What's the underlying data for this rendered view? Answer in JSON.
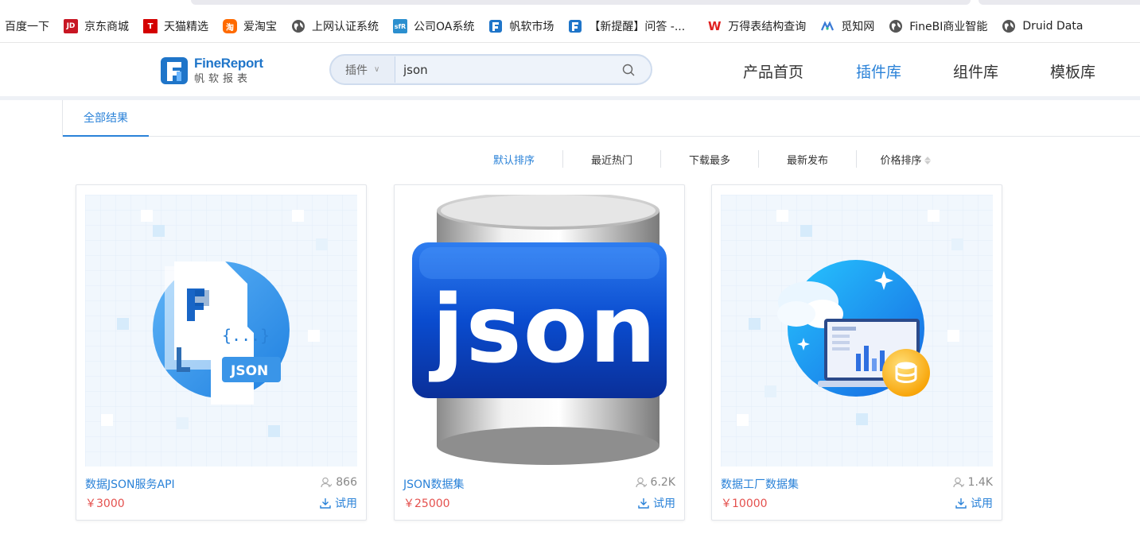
{
  "bookmarks": [
    {
      "label": "百度一下",
      "icon": "none"
    },
    {
      "label": "京东商城",
      "icon": "jd-icon",
      "mark": "JD",
      "color": "#c81623"
    },
    {
      "label": "天猫精选",
      "icon": "tmall-icon",
      "mark": "T",
      "color": "#d40000"
    },
    {
      "label": "爱淘宝",
      "icon": "taobao-icon",
      "mark": "淘",
      "color": "#ff6a00"
    },
    {
      "label": "上网认证系统",
      "icon": "globe-icon",
      "mark": "",
      "color": "#555555"
    },
    {
      "label": "公司OA系统",
      "icon": "oa-icon",
      "mark": "sfR",
      "color": "#2b8fcf"
    },
    {
      "label": "帆软市场",
      "icon": "fanruan-icon",
      "mark": "",
      "color": "#1f75c9"
    },
    {
      "label": "【新提醒】问答 -...",
      "icon": "fanruan-icon",
      "mark": "",
      "color": "#1f75c9"
    },
    {
      "label": "万得表结构查询",
      "icon": "wind-icon",
      "mark": "W",
      "color": "#e02020"
    },
    {
      "label": "觅知网",
      "icon": "mizhi-icon",
      "mark": "",
      "color": "#3a7bd5"
    },
    {
      "label": "FineBI商业智能",
      "icon": "globe-icon",
      "mark": "",
      "color": "#555555"
    },
    {
      "label": "Druid Data",
      "icon": "globe-icon",
      "mark": "",
      "color": "#555555"
    }
  ],
  "header": {
    "logo_en": "FineReport",
    "logo_cn": "帆软报表",
    "search": {
      "category": "插件",
      "value": "json"
    },
    "nav": [
      "产品首页",
      "插件库",
      "组件库",
      "模板库"
    ],
    "active_nav": "插件库"
  },
  "tabs": {
    "all": "全部结果"
  },
  "sort": [
    "默认排序",
    "最近热门",
    "下载最多",
    "最新发布",
    "价格排序"
  ],
  "cards": [
    {
      "title": "数据JSON服务API",
      "downloads": "866",
      "price": "￥3000",
      "action": "试用",
      "badge": "JSON"
    },
    {
      "title": "JSON数据集",
      "downloads": "6.2K",
      "price": "￥25000",
      "action": "试用",
      "badge": "json"
    },
    {
      "title": "数据工厂数据集",
      "downloads": "1.4K",
      "price": "￥10000",
      "action": "试用"
    }
  ],
  "colors": {
    "accent": "#2a82d8",
    "price": "#e4504d"
  }
}
